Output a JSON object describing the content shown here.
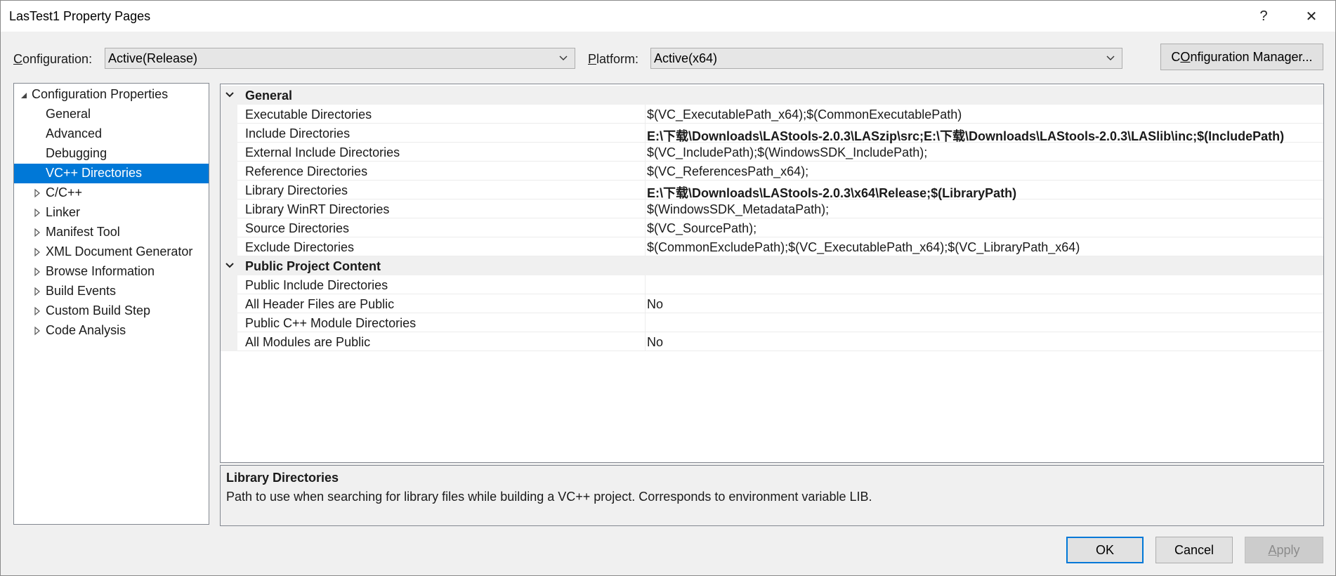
{
  "window": {
    "title": "LasTest1 Property Pages",
    "help_glyph": "?",
    "close_glyph": "✕"
  },
  "toolbar": {
    "configuration_label_key": "C",
    "configuration_label_rest": "onfiguration:",
    "configuration_value": "Active(Release)",
    "platform_label_key": "P",
    "platform_label_rest": "latform:",
    "platform_value": "Active(x64)",
    "config_manager_key": "O",
    "config_manager_pre": "C",
    "config_manager_rest": "nfiguration Manager..."
  },
  "tree": {
    "root": "Configuration Properties",
    "items": [
      {
        "label": "General"
      },
      {
        "label": "Advanced"
      },
      {
        "label": "Debugging"
      },
      {
        "label": "VC++ Directories"
      },
      {
        "label": "C/C++"
      },
      {
        "label": "Linker"
      },
      {
        "label": "Manifest Tool"
      },
      {
        "label": "XML Document Generator"
      },
      {
        "label": "Browse Information"
      },
      {
        "label": "Build Events"
      },
      {
        "label": "Custom Build Step"
      },
      {
        "label": "Code Analysis"
      }
    ]
  },
  "grid": {
    "categories": [
      {
        "name": "General",
        "rows": [
          {
            "name": "Executable Directories",
            "value": "$(VC_ExecutablePath_x64);$(CommonExecutablePath)"
          },
          {
            "name": "Include Directories",
            "value": "E:\\下载\\Downloads\\LAStools-2.0.3\\LASzip\\src;E:\\下载\\Downloads\\LAStools-2.0.3\\LASlib\\inc;$(IncludePath)"
          },
          {
            "name": "External Include Directories",
            "value": "$(VC_IncludePath);$(WindowsSDK_IncludePath);"
          },
          {
            "name": "Reference Directories",
            "value": "$(VC_ReferencesPath_x64);"
          },
          {
            "name": "Library Directories",
            "value": "E:\\下载\\Downloads\\LAStools-2.0.3\\x64\\Release;$(LibraryPath)"
          },
          {
            "name": "Library WinRT Directories",
            "value": "$(WindowsSDK_MetadataPath);"
          },
          {
            "name": "Source Directories",
            "value": "$(VC_SourcePath);"
          },
          {
            "name": "Exclude Directories",
            "value": "$(CommonExcludePath);$(VC_ExecutablePath_x64);$(VC_LibraryPath_x64)"
          }
        ]
      },
      {
        "name": "Public Project Content",
        "rows": [
          {
            "name": "Public Include Directories",
            "value": ""
          },
          {
            "name": "All Header Files are Public",
            "value": "No"
          },
          {
            "name": "Public C++ Module Directories",
            "value": ""
          },
          {
            "name": "All Modules are Public",
            "value": "No"
          }
        ]
      }
    ]
  },
  "description": {
    "title": "Library Directories",
    "text": "Path to use when searching for library files while building a VC++ project.  Corresponds to environment variable LIB."
  },
  "buttons": {
    "ok": "OK",
    "cancel": "Cancel",
    "apply_key": "A",
    "apply_rest": "pply"
  },
  "colors": {
    "selection": "#0078d7",
    "background": "#f0f0f0"
  }
}
